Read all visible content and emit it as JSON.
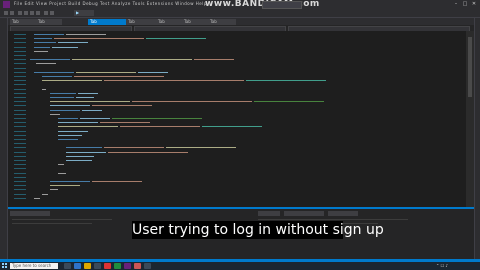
{
  "watermark": "www.BANDICAM.com",
  "menu": "File  Edit  View  Project  Build  Debug  Test  Analyze  Tools  Extensions  Window  Help",
  "tabs": [
    "Tab",
    "Tab",
    "Tab",
    "Tab",
    "Tab",
    "Tab",
    "Tab"
  ],
  "caption": "User trying to log in without sign up",
  "taskbar": {
    "search_placeholder": "Type here to search"
  },
  "colors": {
    "editor_bg": "#1e1e1e",
    "accent": "#007acc",
    "caption_bg": "#000000",
    "caption_text": "#ffffff"
  }
}
